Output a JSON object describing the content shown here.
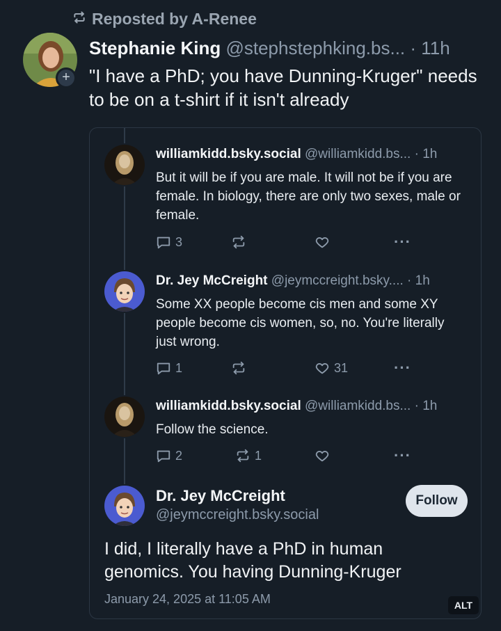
{
  "repost": {
    "label": "Reposted by A-Renee"
  },
  "main_post": {
    "author_name": "Stephanie King",
    "handle": "@stephstephking.bs...",
    "time": "· 11h",
    "text": "\"I have a PhD; you have Dunning-Kruger\" needs to be on a t-shirt if it isn't already"
  },
  "replies": [
    {
      "author_name": "williamkidd.bsky.social",
      "handle": "@williamkidd.bs...",
      "time": "· 1h",
      "text": "But it will be if you are male. It will not be if you are female. In biology, there are only two sexes, male or female.",
      "reply_count": "3",
      "repost_count": "",
      "like_count": ""
    },
    {
      "author_name": "Dr. Jey McCreight",
      "handle": "@jeymccreight.bsky....",
      "time": "· 1h",
      "text": "Some XX people become cis men and some XY people become cis women, so, no. You're literally just wrong.",
      "reply_count": "1",
      "repost_count": "",
      "like_count": "31"
    },
    {
      "author_name": "williamkidd.bsky.social",
      "handle": "@williamkidd.bs...",
      "time": "· 1h",
      "text": "Follow the science.",
      "reply_count": "2",
      "repost_count": "1",
      "like_count": ""
    }
  ],
  "final_post": {
    "author_name": "Dr. Jey McCreight",
    "handle": "@jeymccreight.bsky.social",
    "follow_label": "Follow",
    "text": "I did, I literally have a PhD in human genomics. You having Dunning-Kruger",
    "timestamp": "January 24, 2025 at 11:05 AM",
    "alt_label": "ALT"
  },
  "icons": {
    "repost": "repost-icon",
    "reply": "reply-icon",
    "like": "heart-icon",
    "more": "more-dots-icon",
    "plus": "plus-icon"
  },
  "colors": {
    "background": "#161e27",
    "text_primary": "#f1f3f5",
    "text_muted": "#8d9bab",
    "button_bg": "#dfe5ec"
  }
}
